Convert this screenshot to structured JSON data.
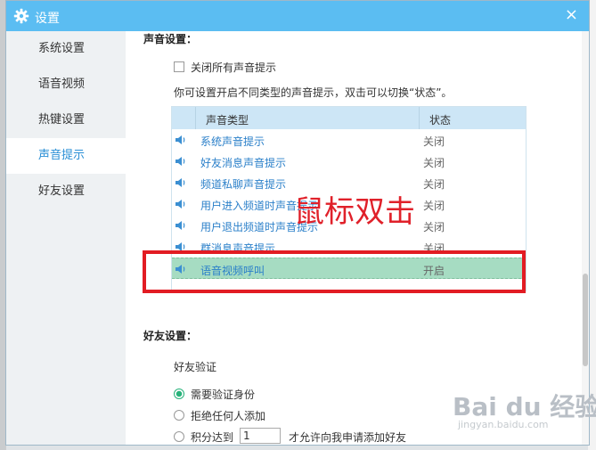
{
  "window": {
    "title": "设置",
    "close_glyph": "×",
    "icon": "gear-icon"
  },
  "sidebar": {
    "items": [
      {
        "label": "系统设置"
      },
      {
        "label": "语音视频"
      },
      {
        "label": "热键设置"
      },
      {
        "label": "声音提示",
        "active": true
      },
      {
        "label": "好友设置"
      }
    ]
  },
  "sound": {
    "title": "声音设置：",
    "mute_all_label": "关闭所有声音提示",
    "mute_all_checked": false,
    "hint": "你可设置开启不同类型的声音提示，双击可以切换“状态”。",
    "table": {
      "headers": {
        "type": "声音类型",
        "state": "状态"
      },
      "rows": [
        {
          "name": "系统声音提示",
          "state": "关闭"
        },
        {
          "name": "好友消息声音提示",
          "state": "关闭"
        },
        {
          "name": "频道私聊声音提示",
          "state": "关闭"
        },
        {
          "name": "用户进入频道时声音提示",
          "state": "关闭"
        },
        {
          "name": "用户退出频道时声音提示",
          "state": "关闭"
        },
        {
          "name": "群消息声音提示",
          "state": "关闭"
        },
        {
          "name": "语音视频呼叫",
          "state": "开启",
          "selected": true
        }
      ]
    },
    "annotation": "鼠标双击"
  },
  "friend": {
    "title": "好友设置：",
    "verify_label": "好友验证",
    "options": [
      {
        "label": "需要验证身份",
        "checked": true
      },
      {
        "label": "拒绝任何人添加",
        "checked": false
      },
      {
        "label_before": "积分达到",
        "value": "1",
        "label_after": "才允许向我申请添加好友",
        "checked": false
      }
    ]
  },
  "watermark": {
    "text": "Bai du 经验",
    "sub": "jingyan.baidu.com"
  },
  "colors": {
    "titlebar": "#5bbdf2",
    "accent": "#2a8fd6",
    "selected_row": "#a6dcc2",
    "annotation": "#e0212a"
  }
}
